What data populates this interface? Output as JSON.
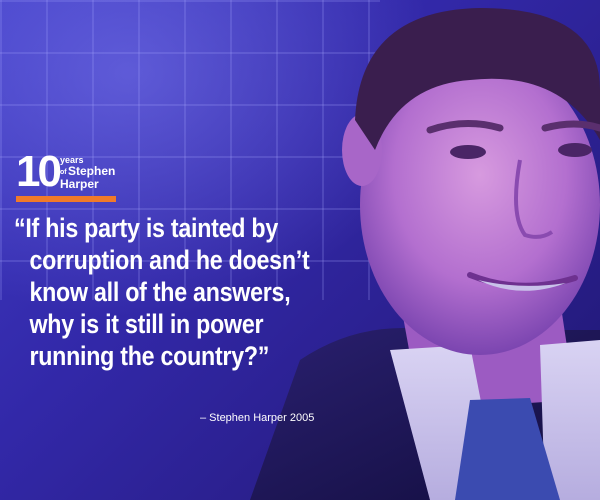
{
  "logo": {
    "number": "10",
    "years": "years",
    "of": "of",
    "name_first": "Stephen",
    "name_last": "Harper"
  },
  "quote": {
    "lines": [
      "“If his party is tainted by",
      "corruption and he doesn’t",
      "know all of the answers,",
      "why is it still in power",
      "running the country?”"
    ]
  },
  "attribution": "– Stephen Harper 2005",
  "colors": {
    "background": "#3228a8",
    "accent": "#f07a2a",
    "text": "#ffffff"
  }
}
